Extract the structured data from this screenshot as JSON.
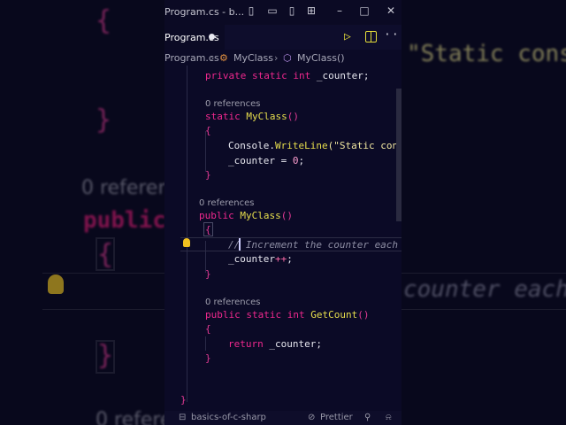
{
  "background": {
    "refs_label": "0 references",
    "static_cons": "\"Static cons",
    "public_kw": "public",
    "comment_tail": "counter each",
    "refs_bottom": "0 refere"
  },
  "window": {
    "title": "Program.cs - b...",
    "active_tab": "Program.cs",
    "breadcrumb": [
      "Program.cs",
      "MyClass",
      "MyClass()"
    ],
    "status_branch": "basics-of-c-sharp",
    "status_formatter": "Prettier"
  },
  "code": {
    "field_line": [
      "private",
      "static",
      "int",
      "_counter;"
    ],
    "lens1": "0 references",
    "static_ctor": [
      "static",
      "MyClass",
      "()"
    ],
    "console_obj": "Console.",
    "console_fn": "WriteLine",
    "console_str": "(\"Static cons",
    "counter_assign": "_counter = ",
    "zero": "0",
    "lens2": "0 references",
    "public_ctor": [
      "public",
      "MyClass",
      "()"
    ],
    "comment": "// Increment the counter each",
    "increment": "_counter",
    "increment_op": "++",
    "lens3": "0 references",
    "getcount": [
      "public",
      "static",
      "int",
      "GetCount",
      "()"
    ],
    "return_kw": "return",
    "return_val": " _counter;"
  },
  "colors": {
    "keyword": "#f0288e",
    "function": "#e8df4d",
    "string": "#f0e6a0",
    "comment": "#8e8ea4",
    "accent": "#e4dc3a"
  }
}
